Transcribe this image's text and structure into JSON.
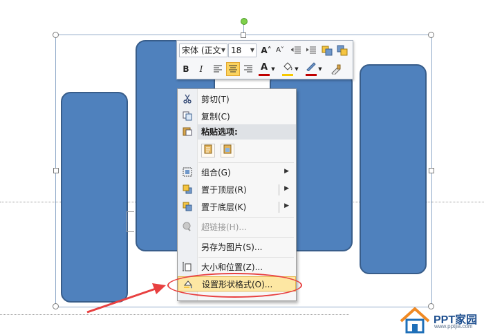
{
  "mini_toolbar": {
    "font_name": "宋体 (正文",
    "font_size": "18",
    "grow_font_icon": "A˄",
    "shrink_font_icon": "A˅",
    "bold": "B",
    "italic": "I",
    "font_color": "#c00000",
    "highlight_color": "#f7c800",
    "outline_color": "#c00000"
  },
  "context_menu": {
    "items": [
      {
        "label": "剪切(T)",
        "icon": "scissors-icon"
      },
      {
        "label": "复制(C)",
        "icon": "copy-icon"
      },
      {
        "label": "粘贴选项:",
        "icon": "paste-icon"
      },
      {
        "label": "组合(G)",
        "icon": "group-icon"
      },
      {
        "label": "置于顶层(R)",
        "icon": "bring-to-front-icon"
      },
      {
        "label": "置于底层(K)",
        "icon": "send-to-back-icon"
      },
      {
        "label": "超链接(H)...",
        "icon": "hyperlink-icon"
      },
      {
        "label": "另存为图片(S)...",
        "icon": ""
      },
      {
        "label": "大小和位置(Z)...",
        "icon": "size-position-icon"
      },
      {
        "label": "设置形状格式(O)...",
        "icon": "format-shape-icon"
      }
    ]
  },
  "colors": {
    "shape_fill": "#4f81bd",
    "annotation": "#e84040"
  },
  "watermark": {
    "brand": "PPT家园",
    "url": "www.pptjia.com"
  }
}
